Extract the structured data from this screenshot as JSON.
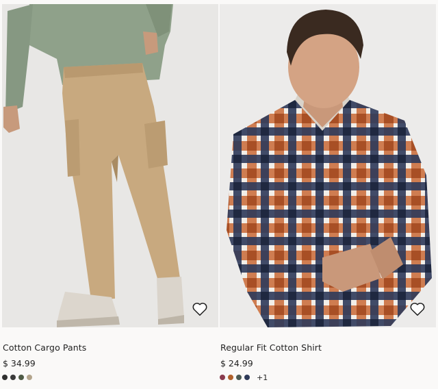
{
  "products": [
    {
      "name": "Cotton Cargo Pants",
      "price": "$ 34.99",
      "swatches": [
        "#2f2f2f",
        "#3a3a3a",
        "#4e5a45",
        "#b3a48c"
      ],
      "more_colors": "",
      "favorite_icon": "heart-outline-icon"
    },
    {
      "name": "Regular Fit Cotton Shirt",
      "price": "$ 24.99",
      "swatches": [
        "#8a3b4e",
        "#b0612b",
        "#4b5a53",
        "#2e3a59"
      ],
      "more_colors": "+1",
      "favorite_icon": "heart-outline-icon"
    }
  ]
}
